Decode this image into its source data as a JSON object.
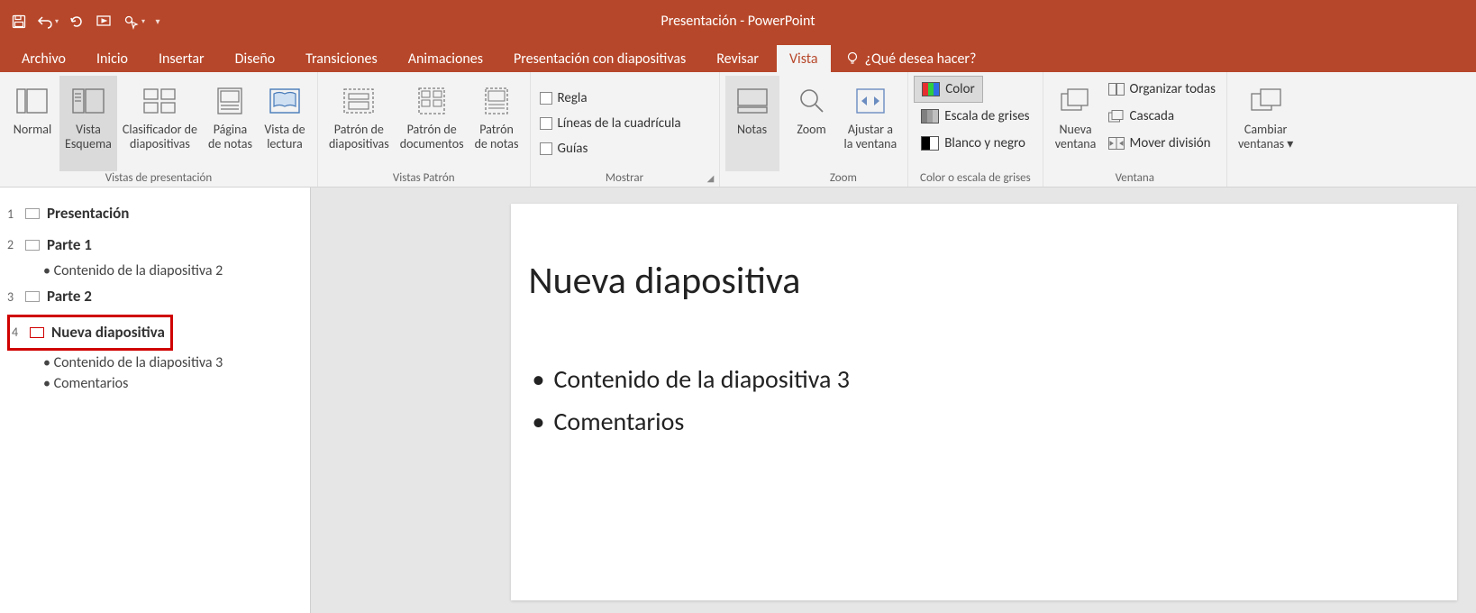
{
  "title": "Presentación - PowerPoint",
  "qat": {
    "save": "save-icon",
    "undo": "undo-icon",
    "redo": "redo-icon",
    "start": "slideshow-start-icon",
    "touch": "touch-mouse-icon"
  },
  "tabs": {
    "archivo": "Archivo",
    "inicio": "Inicio",
    "insertar": "Insertar",
    "diseno": "Diseño",
    "transiciones": "Transiciones",
    "animaciones": "Animaciones",
    "presentacion": "Presentación con diapositivas",
    "revisar": "Revisar",
    "vista": "Vista"
  },
  "tellme": "¿Qué desea hacer?",
  "ribbon": {
    "groups": {
      "vistasPresentacion": "Vistas de presentación",
      "vistasPatron": "Vistas Patrón",
      "mostrar": "Mostrar",
      "zoom": "Zoom",
      "colorGris": "Color o escala de grises",
      "ventana": "Ventana"
    },
    "normal": "Normal",
    "esquema": {
      "l1": "Vista",
      "l2": "Esquema"
    },
    "clasificador": {
      "l1": "Clasificador de",
      "l2": "diapositivas"
    },
    "paginaNotas": {
      "l1": "Página",
      "l2": "de notas"
    },
    "vistaLectura": {
      "l1": "Vista de",
      "l2": "lectura"
    },
    "patronDiapos": {
      "l1": "Patrón de",
      "l2": "diapositivas"
    },
    "patronDocs": {
      "l1": "Patrón de",
      "l2": "documentos"
    },
    "patronNotas": {
      "l1": "Patrón",
      "l2": "de notas"
    },
    "regla": "Regla",
    "cuadricula": "Líneas de la cuadrícula",
    "guias": "Guías",
    "notas": "Notas",
    "zoomBtn": "Zoom",
    "ajustar": {
      "l1": "Ajustar a",
      "l2": "la ventana"
    },
    "color": "Color",
    "grises": "Escala de grises",
    "bn": "Blanco y negro",
    "nuevaVentana": {
      "l1": "Nueva",
      "l2": "ventana"
    },
    "organizar": "Organizar todas",
    "cascada": "Cascada",
    "moverDiv": "Mover división",
    "cambiar": {
      "l1": "Cambiar",
      "l2": "ventanas"
    }
  },
  "outline": {
    "s1": {
      "n": "1",
      "t": "Presentación"
    },
    "s2": {
      "n": "2",
      "t": "Parte 1",
      "b1": "• Contenido de la diapositiva 2"
    },
    "s3": {
      "n": "3",
      "t": "Parte 2"
    },
    "s4": {
      "n": "4",
      "t": "Nueva diapositiva",
      "b1": "• Contenido de la diapositiva 3",
      "b2": "• Comentarios"
    }
  },
  "slide": {
    "title": "Nueva diapositiva",
    "b1": "Contenido de la diapositiva 3",
    "b2": "Comentarios"
  }
}
